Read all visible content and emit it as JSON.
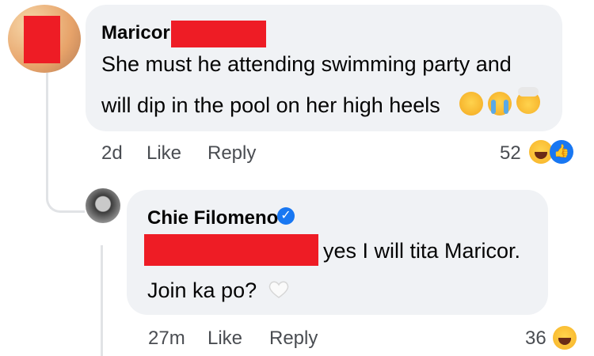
{
  "comment1": {
    "author": "Maricor",
    "line1": "She must he attending swimming party and",
    "line2": "will dip in the pool on her high heels",
    "inline_emojis": [
      "zany-face-icon",
      "loudly-crying-face-icon",
      "exploding-head-icon"
    ],
    "time": "2d",
    "like_label": "Like",
    "reply_label": "Reply",
    "reaction_count": "52",
    "reactions": [
      "haha-reaction-icon",
      "like-reaction-icon"
    ]
  },
  "comment2": {
    "author": "Chie Filomeno",
    "verified": true,
    "line1": "yes I will tita Maricor.",
    "line2": "Join ka po?",
    "inline_emojis": [
      "white-heart-icon"
    ],
    "time": "27m",
    "like_label": "Like",
    "reply_label": "Reply",
    "reaction_count": "36",
    "reactions": [
      "haha-reaction-icon"
    ]
  },
  "colors": {
    "bubble": "#f0f2f5",
    "redaction": "#ee1c25",
    "link": "#1877f2",
    "meta_text": "#4a4d52"
  }
}
